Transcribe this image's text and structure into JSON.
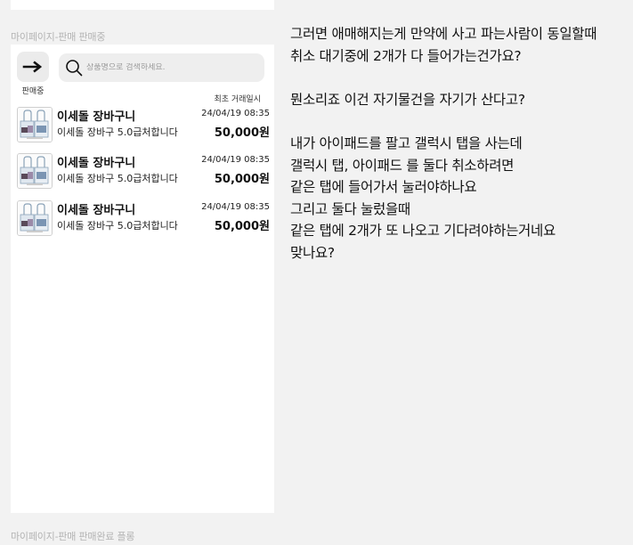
{
  "section_labels": {
    "selling": "마이페이지-판매 판매중",
    "completed": "마이페이지-판매 판매완료 플롱"
  },
  "panel": {
    "tab_label": "판매중",
    "search": {
      "placeholder": "상품명으로 검색하세요."
    },
    "date_header": "최초 거래일시",
    "items": [
      {
        "title": "이세돌 장바구니",
        "subtitle": "이세돌 장바구 5.0급처합니다",
        "date": "24/04/19 08:35",
        "price": "50,000원"
      },
      {
        "title": "이세돌 장바구니",
        "subtitle": "이세돌 장바구 5.0급처합니다",
        "date": "24/04/19 08:35",
        "price": "50,000원"
      },
      {
        "title": "이세돌 장바구니",
        "subtitle": "이세돌 장바구 5.0급처합니다",
        "date": "24/04/19 08:35",
        "price": "50,000원"
      }
    ]
  },
  "message": {
    "lines": [
      "그러면 애매해지는게 만약에 사고 파는사람이 동일할때",
      "취소 대기중에 2개가 다 들어가는건가요?",
      "",
      "뭔소리죠 이건 자기물건을 자기가 산다고?",
      "",
      "내가 아이패드를 팔고 갤럭시 탭을 사는데",
      "갤럭시 탭, 아이패드 를 둘다 취소하려면",
      "같은 탭에 들어가서 눌러야하나요",
      "그리고 둘다 눌렀을때",
      "같은 탭에 2개가 또 나오고 기다려야하는거네요",
      "맞나요?"
    ]
  },
  "colors": {
    "background": "#f2f2f2",
    "panel": "#ffffff",
    "search_bg": "#eeeeee",
    "label_gray": "#b3b3b3"
  }
}
